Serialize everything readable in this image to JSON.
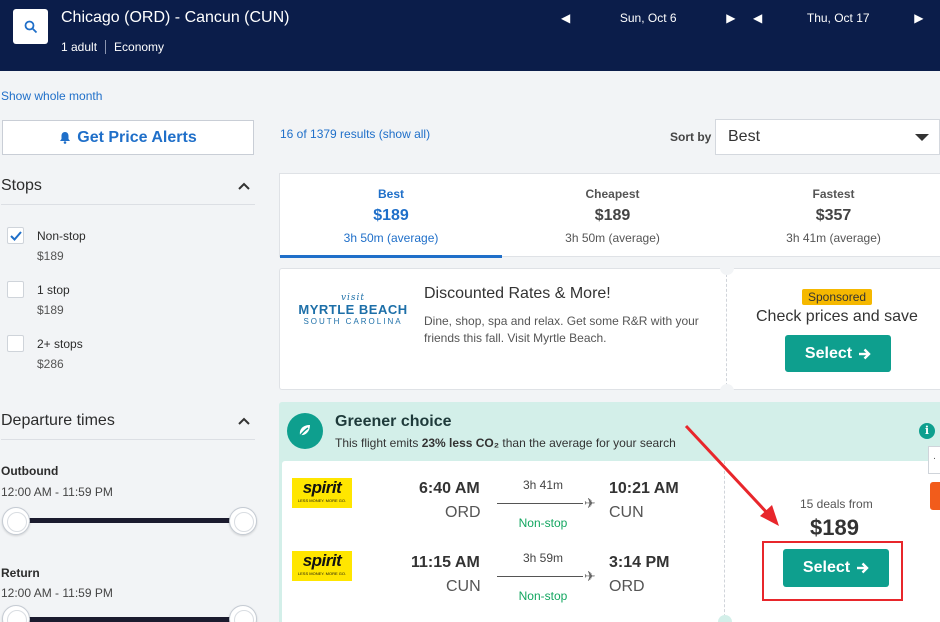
{
  "header": {
    "route": "Chicago (ORD) - Cancun (CUN)",
    "travelers": "1 adult",
    "cabin": "Economy",
    "depart_date": "Sun, Oct 6",
    "return_date": "Thu, Oct 17",
    "prev_glyph": "◀",
    "next_glyph": "▶"
  },
  "links": {
    "show_month": "Show whole month"
  },
  "sidebar": {
    "price_alert_label": "Get Price Alerts",
    "stops": {
      "title": "Stops",
      "items": [
        {
          "label": "Non-stop",
          "price": "$189",
          "checked": true
        },
        {
          "label": "1 stop",
          "price": "$189",
          "checked": false
        },
        {
          "label": "2+ stops",
          "price": "$286",
          "checked": false
        }
      ]
    },
    "departure_times": {
      "title": "Departure times",
      "outbound_label": "Outbound",
      "outbound_range": "12:00 AM - 11:59 PM",
      "return_label": "Return",
      "return_range": "12:00 AM - 11:59 PM"
    }
  },
  "results": {
    "count_text": "16 of 1379 results (show all)",
    "sort_label": "Sort by",
    "sort_value": "Best"
  },
  "tabs": [
    {
      "label": "Best",
      "price": "$189",
      "duration": "3h 50m (average)",
      "active": true
    },
    {
      "label": "Cheapest",
      "price": "$189",
      "duration": "3h 50m (average)",
      "active": false
    },
    {
      "label": "Fastest",
      "price": "$357",
      "duration": "3h 41m (average)",
      "active": false
    }
  ],
  "ad": {
    "logo_visit": "visit",
    "logo_name": "MYRTLE BEACH",
    "logo_state": "SOUTH CAROLINA",
    "title": "Discounted Rates & More!",
    "description": "Dine, shop, spa and relax. Get some R&R with your friends this fall. Visit Myrtle Beach.",
    "badge": "Sponsored",
    "cta_text": "Check prices and save",
    "button_label": "Select"
  },
  "green": {
    "title": "Greener choice",
    "desc_prefix": "This flight emits ",
    "desc_bold": "23% less CO₂",
    "desc_suffix": " than the average for your search",
    "info_glyph": "i"
  },
  "flight": {
    "airline_logo_text": "spirit",
    "airline_logo_tagline": "LESS MONEY. MORE GO.",
    "legs": [
      {
        "depart_time": "6:40 AM",
        "depart_code": "ORD",
        "duration": "3h 41m",
        "stops": "Non-stop",
        "arrive_time": "10:21 AM",
        "arrive_code": "CUN"
      },
      {
        "depart_time": "11:15 AM",
        "depart_code": "CUN",
        "duration": "3h 59m",
        "stops": "Non-stop",
        "arrive_time": "3:14 PM",
        "arrive_code": "ORD"
      }
    ],
    "deals_text": "15 deals from",
    "price": "$189",
    "button_label": "Select"
  },
  "edge_tab_glyph": "·",
  "colors": {
    "header_bg": "#0b1d4a",
    "accent_blue": "#1f6fc9",
    "teal": "#0e9f8e",
    "green_bg": "#d3efe9",
    "sponsored": "#f5b800",
    "annotation_red": "#e8262b"
  }
}
